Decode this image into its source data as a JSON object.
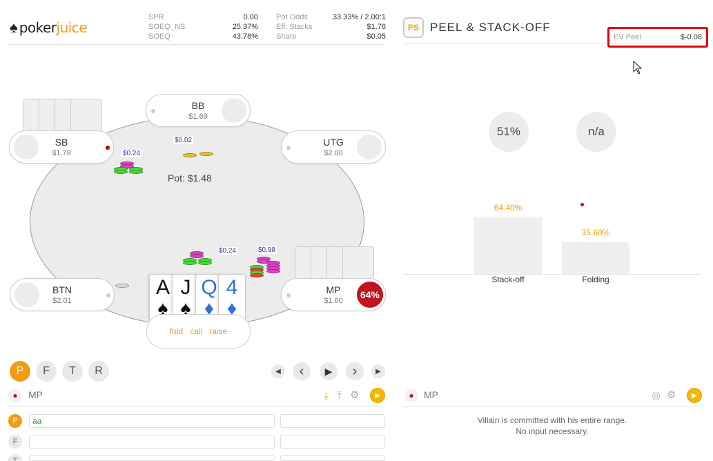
{
  "logo": {
    "poker": "poker",
    "juice": "juice"
  },
  "stats": {
    "left": [
      {
        "label": "SPR",
        "value": "0.00"
      },
      {
        "label": "SOEQ_NS",
        "value": "25.37%"
      },
      {
        "label": "SOEQ",
        "value": "43.78%"
      }
    ],
    "right": [
      {
        "label": "Pot Odds",
        "value": "33.33% / 2.00:1"
      },
      {
        "label": "Eff. Stacks",
        "value": "$1.76"
      },
      {
        "label": "Share",
        "value": "$0.05"
      }
    ]
  },
  "table": {
    "pot": "Pot: $1.48",
    "seats": {
      "bb": {
        "name": "BB",
        "stack": "$1.69"
      },
      "sb": {
        "name": "SB",
        "stack": "$1.78"
      },
      "utg": {
        "name": "UTG",
        "stack": "$2.00"
      },
      "btn": {
        "name": "BTN",
        "stack": "$2.01"
      },
      "mp": {
        "name": "MP",
        "stack": "$1.60"
      }
    },
    "bets": {
      "sb": "$0.24",
      "bb": "$0.02",
      "hero": "$0.24",
      "mp": "$0.98"
    },
    "hero_cards": [
      {
        "rank": "A",
        "suit": "♠",
        "color": "black"
      },
      {
        "rank": "J",
        "suit": "♠",
        "color": "black"
      },
      {
        "rank": "Q",
        "suit": "♦",
        "color": "blue"
      },
      {
        "rank": "4",
        "suit": "♦",
        "color": "blue"
      }
    ],
    "actions": {
      "fold": "fold",
      "call": "call",
      "raise": "raise"
    },
    "mp_equity": "64%"
  },
  "streets": [
    "P",
    "F",
    "T",
    "R"
  ],
  "left_player": "MP",
  "range_rows": [
    {
      "letter": "P",
      "value": "aa",
      "active": true
    },
    {
      "letter": "F",
      "value": "",
      "active": false
    },
    {
      "letter": "T",
      "value": "",
      "active": false
    }
  ],
  "panel": {
    "badge": "PS",
    "title": "PEEL & STACK-OFF",
    "ev_label": "EV Peel",
    "ev_value": "$-0.08",
    "circles": [
      "51%",
      "n/a"
    ],
    "bars": [
      {
        "name": "Stack-off",
        "pct": "64.40%",
        "value": 64.4
      },
      {
        "name": "Folding",
        "pct": "35.60%",
        "value": 35.6
      }
    ],
    "player": "MP",
    "message_line1": "Villain is committed with his entire range.",
    "message_line2": "No input necessary."
  }
}
